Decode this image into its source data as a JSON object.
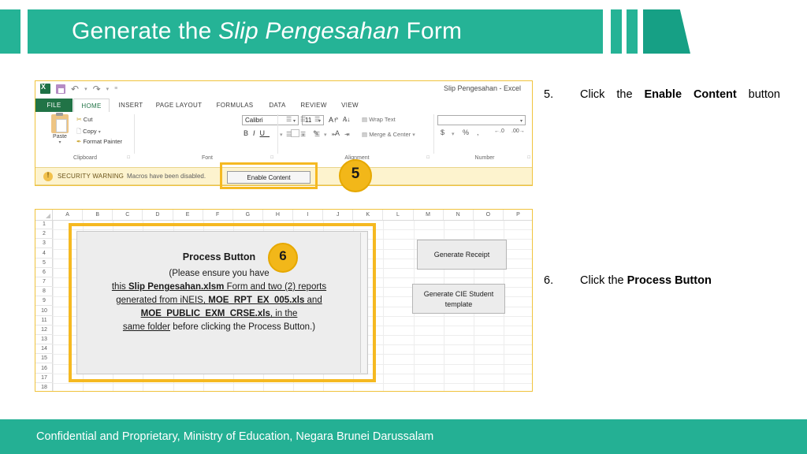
{
  "header": {
    "title_plain_1": "Generate the ",
    "title_italic": "Slip Pengesahan",
    "title_plain_2": " Form",
    "accent_color": "#25B396",
    "wedge_color": "#16A085"
  },
  "excel": {
    "document_title": "Slip Pengesahan - Excel",
    "quick_access": [
      "excel-logo",
      "save-icon",
      "undo-icon",
      "redo-icon",
      "customize-qat-icon"
    ],
    "tabs": [
      "FILE",
      "HOME",
      "INSERT",
      "PAGE LAYOUT",
      "FORMULAS",
      "DATA",
      "REVIEW",
      "VIEW"
    ],
    "active_tab": "HOME",
    "clipboard": {
      "group_label": "Clipboard",
      "paste_label": "Paste",
      "cut_label": "Cut",
      "copy_label": "Copy",
      "format_painter_label": "Format Painter"
    },
    "font": {
      "group_label": "Font",
      "font_name": "Calibri",
      "font_size": "11",
      "bold": "B",
      "italic": "I",
      "underline": "U"
    },
    "alignment": {
      "group_label": "Alignment",
      "wrap_text_label": "Wrap Text",
      "merge_center_label": "Merge & Center"
    },
    "number": {
      "group_label": "Number",
      "format_value": "",
      "currency_symbol": "$",
      "percent_symbol": "%",
      "comma_symbol": ","
    },
    "security_bar": {
      "warning_label": "SECURITY WARNING",
      "message": "Macros have been disabled.",
      "button_label": "Enable Content"
    }
  },
  "sheet": {
    "columns": [
      "A",
      "B",
      "C",
      "D",
      "E",
      "F",
      "G",
      "H",
      "I",
      "J",
      "K",
      "L",
      "M",
      "N",
      "O",
      "P"
    ],
    "rows": [
      "1",
      "2",
      "3",
      "4",
      "5",
      "6",
      "7",
      "8",
      "9",
      "10",
      "11",
      "12",
      "13",
      "14",
      "15",
      "16",
      "17",
      "18"
    ],
    "process_panel": {
      "title": "Process Button",
      "line1": "(Please ensure you have",
      "line2_a": "this ",
      "line2_b": "Slip Pengesahan.xlsm",
      "line2_c": " Form and two (2) reports",
      "line3_a": "generated from iNEIS, ",
      "line3_b": "MOE_RPT_EX_005.xls",
      "line3_c": " and",
      "line4_a": "MOE_PUBLIC_EXM_CRSE.xls",
      "line4_b": ", in the",
      "line5_a": "same folder",
      "line5_b": " before clicking the Process Button.)"
    },
    "buttons": {
      "generate_receipt": "Generate Receipt",
      "generate_cie_line1": "Generate CIE Student",
      "generate_cie_line2": "template"
    },
    "highlight_color": "#F5B921"
  },
  "callouts": {
    "badge5": "5",
    "badge6": "6",
    "badge_color": "#F2B719"
  },
  "instructions": [
    {
      "number": "5.",
      "text_a": "Click the ",
      "text_bold": "Enable Content",
      "text_b": " button"
    },
    {
      "number": "6.",
      "text_a": "Click the ",
      "text_bold": "Process Button",
      "text_b": ""
    }
  ],
  "footer": {
    "text": "Confidential and Proprietary, Ministry of Education, Negara Brunei Darussalam",
    "background": "#24B094"
  }
}
